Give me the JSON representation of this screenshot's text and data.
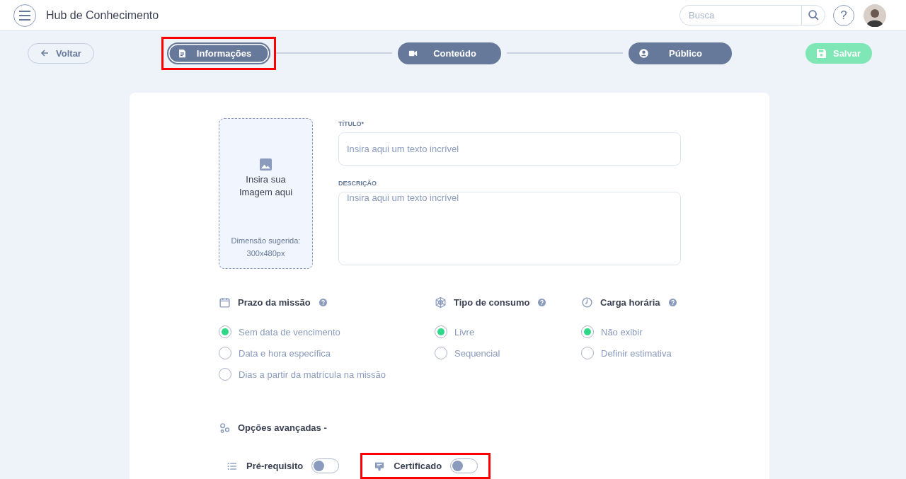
{
  "header": {
    "title": "Hub de Conhecimento",
    "search": {
      "placeholder": "Busca"
    },
    "help": "?"
  },
  "toolbar": {
    "back": "Voltar",
    "save": {
      "label": "Salvar",
      "disabled": true
    }
  },
  "steps": [
    {
      "label": "Informações",
      "kind": "document",
      "selected": true,
      "highlighted": true
    },
    {
      "label": "Conteúdo",
      "kind": "video",
      "selected": false,
      "highlighted": false
    },
    {
      "label": "Público",
      "kind": "user",
      "selected": false,
      "highlighted": false
    }
  ],
  "image_upload": {
    "text": "Insira sua Imagem aqui",
    "hint": "Dimensão sugerida: 300x480px"
  },
  "fields": [
    {
      "label": "TÍTULO*",
      "placeholder": "Insira aqui um texto incrível",
      "kind": "input"
    },
    {
      "label": "DESCRIÇÃO",
      "placeholder": "Insira aqui um texto incrível",
      "kind": "textarea"
    }
  ],
  "option_groups": [
    {
      "title": "Prazo da missão",
      "kind": "calendar",
      "options": [
        {
          "label": "Sem data de vencimento",
          "selected": true
        },
        {
          "label": "Data e hora específica",
          "selected": false
        },
        {
          "label": "Dias a partir da matrícula na missão",
          "selected": false
        }
      ]
    },
    {
      "title": "Tipo de consumo",
      "kind": "web",
      "options": [
        {
          "label": "Livre",
          "selected": true
        },
        {
          "label": "Sequencial",
          "selected": false
        }
      ]
    },
    {
      "title": "Carga horária",
      "kind": "clock",
      "options": [
        {
          "label": "Não exibir",
          "selected": true
        },
        {
          "label": "Definir estimativa",
          "selected": false
        }
      ]
    }
  ],
  "advanced": {
    "title": "Opções avançadas -",
    "toggles": [
      {
        "label": "Pré-requisito",
        "kind": "list",
        "on": false,
        "highlighted": false
      },
      {
        "label": "Certificado",
        "kind": "certificate",
        "on": false,
        "highlighted": true
      }
    ]
  }
}
